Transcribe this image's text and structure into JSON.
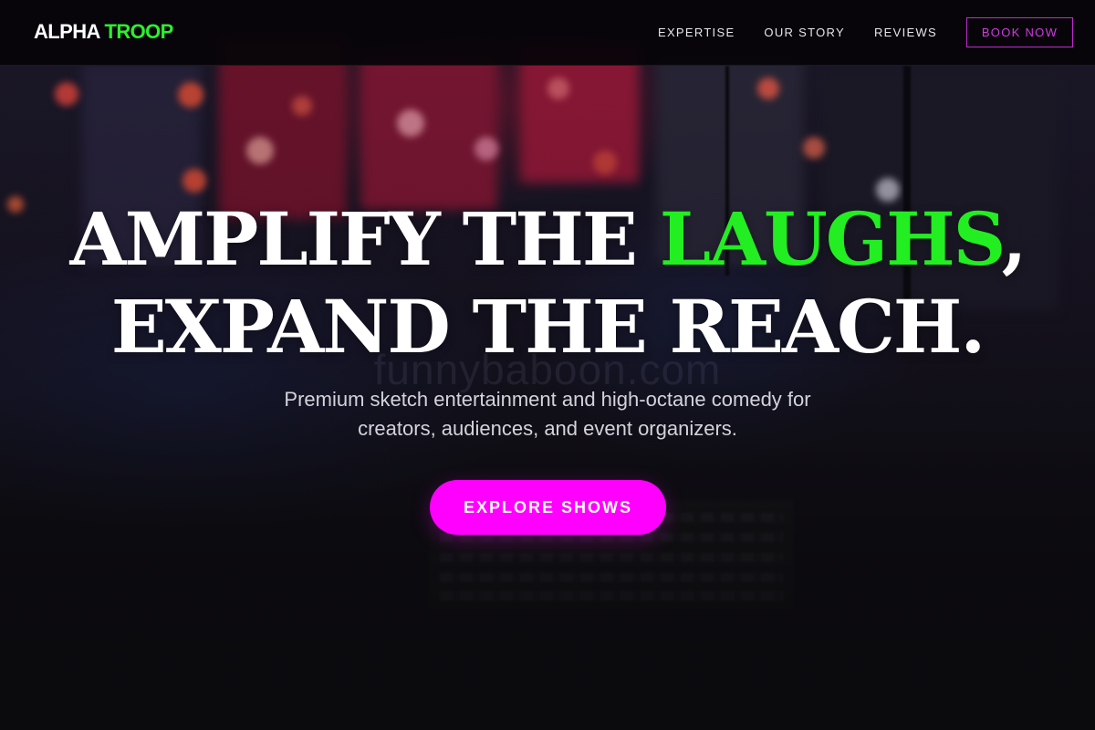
{
  "navbar": {
    "logo_part1": "ALPHA",
    "logo_part2": "TROOP",
    "links": [
      {
        "label": "EXPERTISE"
      },
      {
        "label": "OUR STORY"
      },
      {
        "label": "REVIEWS"
      }
    ],
    "book_label": "BOOK NOW"
  },
  "hero": {
    "headline_line1_pre": "AMPLIFY THE ",
    "headline_accent": "LAUGHS",
    "headline_line1_post": ",",
    "headline_line2": "EXPAND THE REACH.",
    "subtext_line1": "Premium sketch entertainment and high-octane comedy for",
    "subtext_line2": "creators, audiences, and event organizers.",
    "cta_label": "EXPLORE SHOWS",
    "watermark": "funnybaboon.com"
  },
  "colors": {
    "brand_green": "#22ee22",
    "brand_magenta": "#ff00ff",
    "nav_background": "#060408",
    "text_white": "#ffffff"
  }
}
